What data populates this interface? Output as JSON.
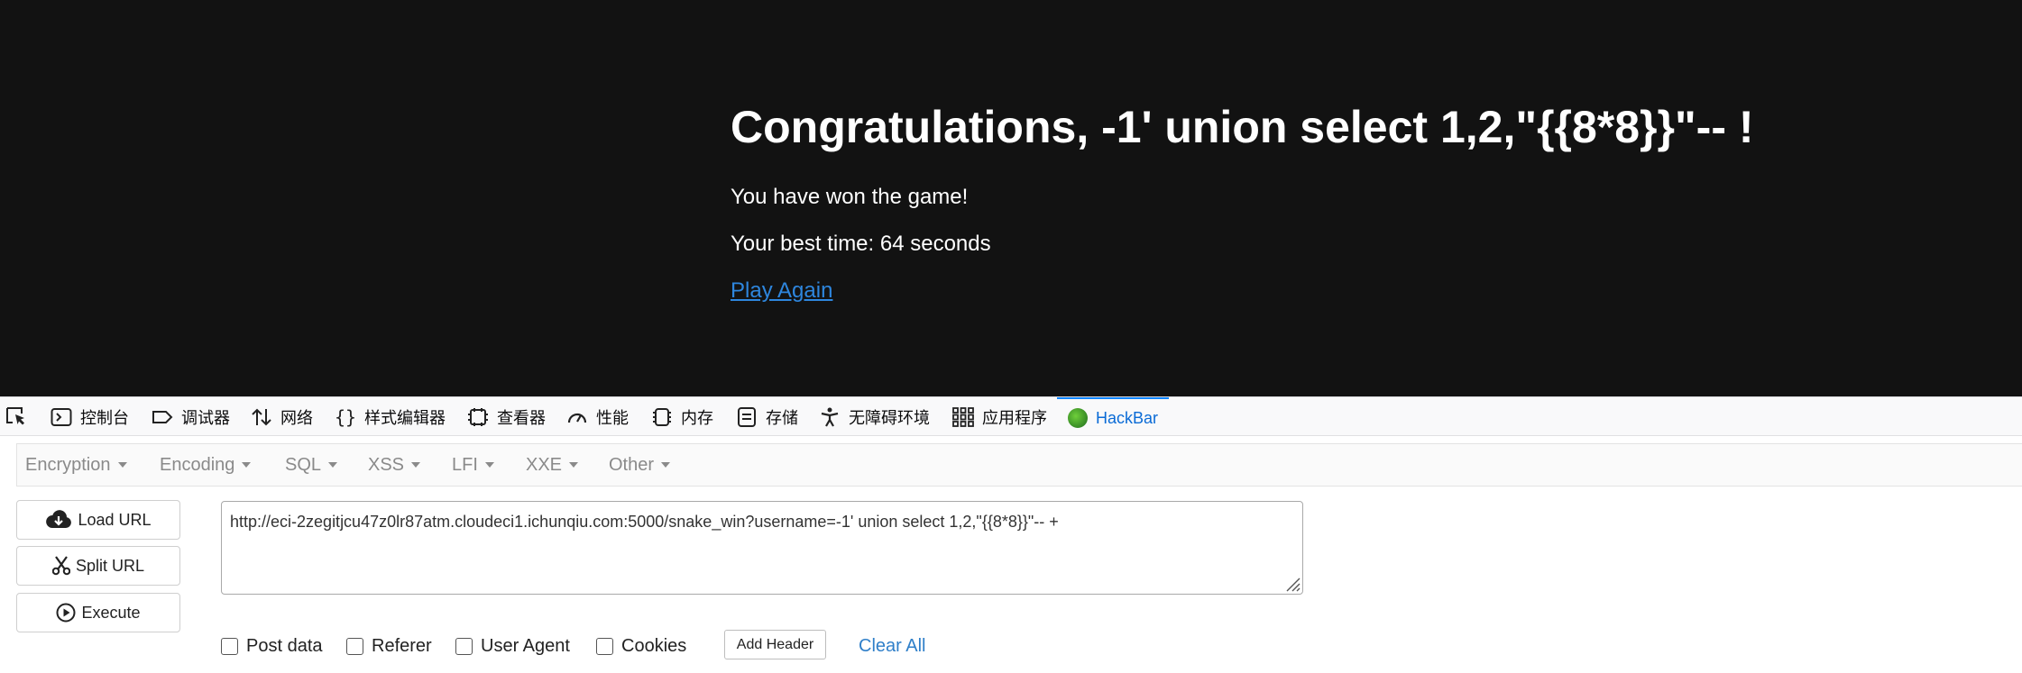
{
  "page": {
    "title": "Congratulations, -1' union select 1,2,\"{{8*8}}\"-- !",
    "won_text": "You have won the game!",
    "best_time": "Your best time: 64 seconds",
    "play_again": "Play Again"
  },
  "devtools": {
    "tabs": [
      {
        "label": "控制台",
        "icon": "console-icon"
      },
      {
        "label": "调试器",
        "icon": "debugger-icon"
      },
      {
        "label": "网络",
        "icon": "network-icon"
      },
      {
        "label": "样式编辑器",
        "icon": "style-editor-icon"
      },
      {
        "label": "查看器",
        "icon": "inspector-icon"
      },
      {
        "label": "性能",
        "icon": "performance-icon"
      },
      {
        "label": "内存",
        "icon": "memory-icon"
      },
      {
        "label": "存储",
        "icon": "storage-icon"
      },
      {
        "label": "无障碍环境",
        "icon": "accessibility-icon"
      },
      {
        "label": "应用程序",
        "icon": "application-icon"
      },
      {
        "label": "HackBar",
        "icon": "hackbar-logo-icon",
        "active": true
      }
    ]
  },
  "hackbar": {
    "menu": [
      "Encryption",
      "Encoding",
      "SQL",
      "XSS",
      "LFI",
      "XXE",
      "Other"
    ],
    "buttons": {
      "load_url": "Load URL",
      "split_url": "Split URL",
      "execute": "Execute"
    },
    "url_value": "http://eci-2zegitjcu47z0lr87atm.cloudeci1.ichunqiu.com:5000/snake_win?username=-1' union select 1,2,\"{{8*8}}\"-- +",
    "options": [
      "Post data",
      "Referer",
      "User Agent",
      "Cookies"
    ],
    "add_header": "Add Header",
    "clear_all": "Clear All"
  },
  "colors": {
    "page_bg": "#121212",
    "link": "#2e86de",
    "active_tab": "#0a84ff"
  }
}
